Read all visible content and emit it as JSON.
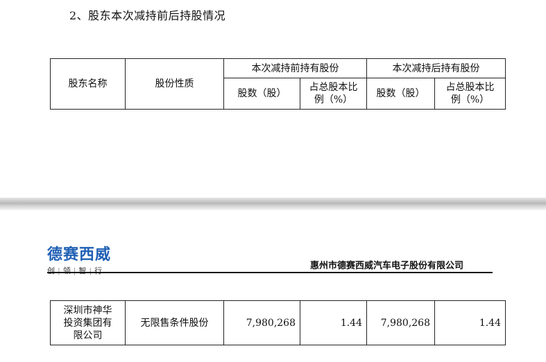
{
  "section": {
    "heading": "2、股东本次减持前后持股情况"
  },
  "table_header": {
    "col_holder": "股东名称",
    "col_nature": "股份性质",
    "group_before": "本次减持前持有股份",
    "group_after": "本次减持后持有股份",
    "shares_label": "股数（股）",
    "ratio_label_line1": "占总股本比",
    "ratio_label_line2": "例（%）"
  },
  "header": {
    "logo_text": "德赛西威",
    "logo_tagline": [
      "创",
      "领",
      "智",
      "行"
    ],
    "company_name": "惠州市德赛西威汽车电子股份有限公司"
  },
  "row": {
    "holder_line1": "深圳市神华",
    "holder_line2": "投资集团有",
    "holder_line3": "限公司",
    "nature": "无限售条件股份",
    "shares_before": "7,980,268",
    "ratio_before": "1.44",
    "shares_after": "7,980,268",
    "ratio_after": "1.44"
  },
  "colors": {
    "logo_blue": "#1f5fb4"
  }
}
